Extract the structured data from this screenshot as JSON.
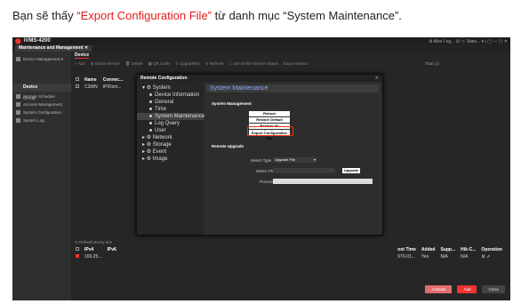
{
  "caption": {
    "pre": "Bạn sẽ thấy ",
    "highlight": "“Export Configuration File”",
    "post": " từ danh mục “System Maintenance”."
  },
  "app": {
    "logo": "⬤",
    "name": "iVMS-4200",
    "tab": "Maintenance and Management ✕",
    "win_user": "⚙ Alex Log... ⊟ ⓢ Stats... ▾ | ▢ — ▢ ✕"
  },
  "sub_tab": "Device",
  "sidebar": [
    "Device Management ▾",
    "Event Configuration ▸",
    "Storage Schedule",
    "Account Management",
    "System Configuration",
    "System Log"
  ],
  "group": {
    "selected": "Device",
    "item": "Group"
  },
  "toolbar": {
    "add": "+ Add",
    "online": "⊕ Online Device",
    "delete": "🗑 Delete",
    "qr": "▦ QR Code",
    "upgrade": "⇧ Upgrade(0)",
    "refresh": "↻ Refresh",
    "activate": "☐ Set Online Device Status",
    "export": "Export Device",
    "total": "Total (1)",
    "filter": "Filter"
  },
  "table1": {
    "headers": [
      "Name",
      "Connec..."
    ],
    "row": [
      "C3WN",
      "IP/Dom..."
    ]
  },
  "lower": {
    "refresh": "↻ Refresh Every 60s",
    "total": "Total (1)",
    "filter": "Filter"
  },
  "table2": {
    "headers": [
      "IPv4",
      "IPv6"
    ],
    "row": [
      "169.25...",
      ""
    ]
  },
  "table3": {
    "headers": [
      "oot Time",
      "Added",
      "Supp...",
      "Hik-C...",
      "Operation"
    ],
    "row": [
      "970-01...",
      "Yes",
      "N/A",
      "N/A",
      "⚙ ⬀"
    ]
  },
  "footer": {
    "activate": "Activate",
    "add": "Add",
    "close": "Close"
  },
  "dialog": {
    "title": "Remote Configuration",
    "close": "✕",
    "tree": [
      {
        "label": "▾ ⚙ System",
        "level": 0
      },
      {
        "label": "Device Information",
        "level": 1
      },
      {
        "label": "General",
        "level": 1
      },
      {
        "label": "Time",
        "level": 1
      },
      {
        "label": "System Maintenance",
        "level": 1,
        "selected": true
      },
      {
        "label": "Log Query",
        "level": 1
      },
      {
        "label": "User",
        "level": 1
      },
      {
        "label": "▸ ⚙ Network",
        "level": 0
      },
      {
        "label": "▸ ⚙ Storage",
        "level": 0
      },
      {
        "label": "▸ ⚙ Event",
        "level": 0
      },
      {
        "label": "▸ ⚙ Image",
        "level": 0
      }
    ],
    "panel_title": "System Maintenance",
    "sys_mgmt": "System Management",
    "reboot": "Reboot",
    "restore_default": "Restore Default Settings",
    "restore_all": "Restore All",
    "import": "Import Configuration File",
    "export": "Export Configuration File",
    "remote_upgrade": "Remote Upgrade",
    "select_type_label": "Select Type",
    "select_type_value": "Upgrade File",
    "select_file_label": "Select File",
    "browse": "···",
    "upgrade": "Upgrade",
    "process_label": "Process"
  }
}
